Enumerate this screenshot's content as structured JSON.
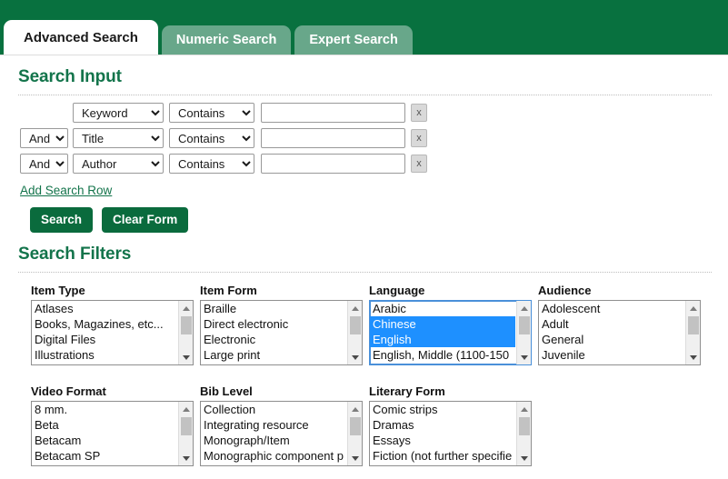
{
  "tabs": [
    {
      "label": "Advanced Search",
      "active": true
    },
    {
      "label": "Numeric Search",
      "active": false
    },
    {
      "label": "Expert Search",
      "active": false
    }
  ],
  "sections": {
    "search_input_title": "Search Input",
    "search_filters_title": "Search Filters"
  },
  "search_rows": [
    {
      "boolean": "",
      "boolean_visible": false,
      "field": "Keyword",
      "operator": "Contains",
      "value": "",
      "remove_label": "x"
    },
    {
      "boolean": "And",
      "boolean_visible": true,
      "field": "Title",
      "operator": "Contains",
      "value": "",
      "remove_label": "x"
    },
    {
      "boolean": "And",
      "boolean_visible": true,
      "field": "Author",
      "operator": "Contains",
      "value": "",
      "remove_label": "x"
    }
  ],
  "add_row_link": "Add Search Row",
  "buttons": {
    "search": "Search",
    "clear": "Clear Form"
  },
  "filters": [
    {
      "label": "Item Type",
      "focused": false,
      "options": [
        {
          "text": "Atlases",
          "selected": false
        },
        {
          "text": "Books, Magazines, etc...",
          "selected": false
        },
        {
          "text": "Digital Files",
          "selected": false
        },
        {
          "text": "Illustrations",
          "selected": false
        }
      ]
    },
    {
      "label": "Item Form",
      "focused": false,
      "options": [
        {
          "text": "Braille",
          "selected": false
        },
        {
          "text": "Direct electronic",
          "selected": false
        },
        {
          "text": "Electronic",
          "selected": false
        },
        {
          "text": "Large print",
          "selected": false
        }
      ]
    },
    {
      "label": "Language",
      "focused": true,
      "options": [
        {
          "text": "Arabic",
          "selected": false
        },
        {
          "text": "Chinese",
          "selected": true
        },
        {
          "text": "English",
          "selected": true
        },
        {
          "text": "English, Middle (1100-150",
          "selected": false
        }
      ]
    },
    {
      "label": "Audience",
      "focused": false,
      "options": [
        {
          "text": "Adolescent",
          "selected": false
        },
        {
          "text": "Adult",
          "selected": false
        },
        {
          "text": "General",
          "selected": false
        },
        {
          "text": "Juvenile",
          "selected": false
        }
      ]
    },
    {
      "label": "Video Format",
      "focused": false,
      "options": [
        {
          "text": "8 mm.",
          "selected": false
        },
        {
          "text": "Beta",
          "selected": false
        },
        {
          "text": "Betacam",
          "selected": false
        },
        {
          "text": "Betacam SP",
          "selected": false
        }
      ]
    },
    {
      "label": "Bib Level",
      "focused": false,
      "options": [
        {
          "text": "Collection",
          "selected": false
        },
        {
          "text": "Integrating resource",
          "selected": false
        },
        {
          "text": "Monograph/Item",
          "selected": false
        },
        {
          "text": "Monographic component p",
          "selected": false
        }
      ]
    },
    {
      "label": "Literary Form",
      "focused": false,
      "options": [
        {
          "text": "Comic strips",
          "selected": false
        },
        {
          "text": "Dramas",
          "selected": false
        },
        {
          "text": "Essays",
          "selected": false
        },
        {
          "text": "Fiction (not further specifie",
          "selected": false
        }
      ]
    }
  ],
  "colors": {
    "header_green": "#08713f",
    "tab_inactive_green": "#68a78a",
    "heading_green": "#13744b",
    "button_green": "#0a6b3d",
    "selection_blue": "#1e90ff",
    "focus_blue": "#4a90d9"
  }
}
